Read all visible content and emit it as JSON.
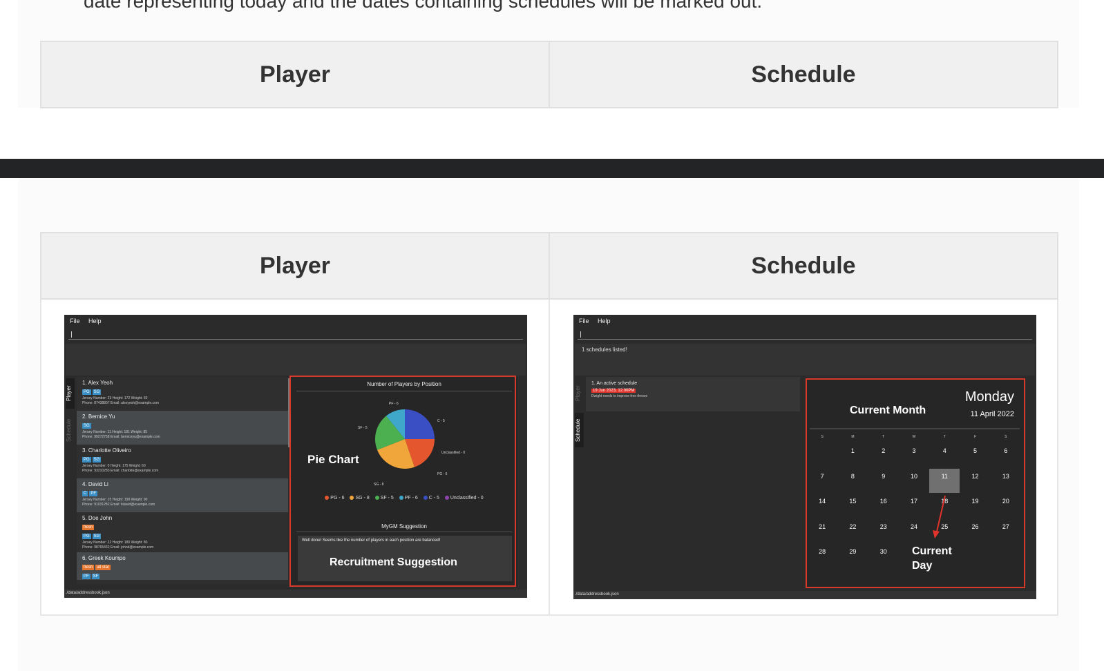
{
  "intro": {
    "text": "date representing today and the dates containing schedules will be marked out."
  },
  "table_top": {
    "col_player": "Player",
    "col_schedule": "Schedule"
  },
  "table_bottom": {
    "col_player": "Player",
    "col_schedule": "Schedule"
  },
  "player_app": {
    "menu": [
      "File",
      "Help"
    ],
    "tabs": {
      "player": "Player",
      "schedule": "Schedule"
    },
    "players": [
      {
        "name": "1. Alex Yeoh",
        "tags": [
          "PG",
          "SG"
        ],
        "info1": "Jersey Number: 23  Height: 172  Weight: 60",
        "info2": "Phone: 87438807  Email: alexyeoh@example.com"
      },
      {
        "name": "2. Bernice Yu",
        "tags": [
          "SG"
        ],
        "info1": "Jersey Number: 11  Height: 181  Weight: 85",
        "info2": "Phone: 99272758  Email: berniceyu@example.com"
      },
      {
        "name": "3. Charlotte Oliveiro",
        "tags": [
          "PG",
          "SG"
        ],
        "info1": "Jersey Number: 0  Height: 175  Weight: 60",
        "info2": "Phone: 93210283  Email: charlotte@example.com"
      },
      {
        "name": "4. David Li",
        "tags": [
          "C",
          "PF"
        ],
        "info1": "Jersey Number: 15  Height: 190  Weight: 90",
        "info2": "Phone: 91031282  Email: lidavid@example.com"
      },
      {
        "name": "5. Doe John",
        "tags_orange": [
          "fresh"
        ],
        "tags": [
          "PG",
          "SG"
        ],
        "info1": "Jersey Number: 22  Height: 180  Weight: 80",
        "info2": "Phone: 98765432  Email: johnd@example.com"
      },
      {
        "name": "6. Greek Koumpo",
        "tags_orange": [
          "fresh",
          "all star"
        ],
        "tags": [
          "PF",
          "SF"
        ]
      }
    ],
    "chart_title": "Number of Players by Position",
    "pie_label": "Pie Chart",
    "legend": [
      "PG - 6",
      "SG - 8",
      "SF - 5",
      "PF - 6",
      "C - 5",
      "Unclassified - 0"
    ],
    "legend_colors": [
      "#e4572e",
      "#f0a63a",
      "#4caf50",
      "#3fa7c9",
      "#3b4fc4",
      "#8e44ad"
    ],
    "slice_labels": [
      "PF - 6",
      "C - 5",
      "Unclassified - 0",
      "PG - 6",
      "SG - 8",
      "SF - 5"
    ],
    "suggestion_title": "MyGM Suggestion",
    "suggestion_text": "Well done! Seems like the number of players in each position are balanced!",
    "suggestion_label": "Recruitment Suggestion",
    "status": "./data/addressbook.json"
  },
  "schedule_app": {
    "menu": [
      "File",
      "Help"
    ],
    "result": "1 schedules listed!",
    "tabs": {
      "player": "Player",
      "schedule": "Schedule"
    },
    "schedule_name": "1. An active schedule",
    "schedule_date": "19 Jun 2023, 12:00PM",
    "schedule_desc": "Dwight needs to improve free throws",
    "day": "Monday",
    "date": "11 April 2022",
    "month_label": "Current Month",
    "weekdays": [
      "S",
      "M",
      "T",
      "W",
      "T",
      "F",
      "S"
    ],
    "weeks": [
      [
        "",
        "1",
        "2",
        "3",
        "4",
        "5",
        "6"
      ],
      [
        "7",
        "8",
        "9",
        "10",
        "11",
        "12",
        "13"
      ],
      [
        "14",
        "15",
        "16",
        "17",
        "18",
        "19",
        "20"
      ],
      [
        "21",
        "22",
        "23",
        "24",
        "25",
        "26",
        "27"
      ],
      [
        "28",
        "29",
        "30",
        "",
        "",
        "",
        ""
      ]
    ],
    "current_day_label": "Current\nDay",
    "status": "./data/addressbook.json"
  }
}
